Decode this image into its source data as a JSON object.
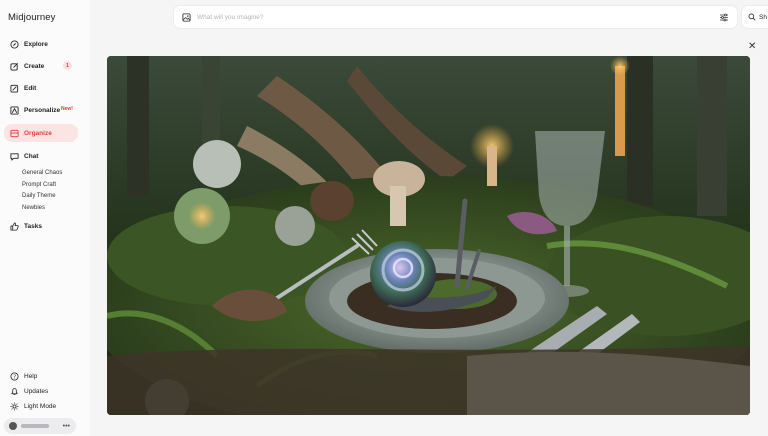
{
  "app": {
    "title": "Midjourney"
  },
  "sidebar": {
    "items": [
      {
        "key": "explore",
        "label": "Explore",
        "icon": "compass-icon"
      },
      {
        "key": "create",
        "label": "Create",
        "icon": "pencil-square-icon",
        "badge": "1"
      },
      {
        "key": "edit",
        "label": "Edit",
        "icon": "edit-icon"
      },
      {
        "key": "personalize",
        "label": "Personalize",
        "icon": "personalize-icon",
        "tag": "New!"
      },
      {
        "key": "organize",
        "label": "Organize",
        "icon": "folder-icon",
        "active": true
      },
      {
        "key": "chat",
        "label": "Chat",
        "icon": "chat-icon"
      },
      {
        "key": "tasks",
        "label": "Tasks",
        "icon": "thumbs-up-icon"
      }
    ],
    "chat_rooms": [
      "General Chaos",
      "Prompt Craft",
      "Daily Theme",
      "Newbies"
    ],
    "bottom": [
      {
        "key": "help",
        "label": "Help",
        "icon": "help-icon"
      },
      {
        "key": "updates",
        "label": "Updates",
        "icon": "bell-icon"
      },
      {
        "key": "light_mode",
        "label": "Light Mode",
        "icon": "sun-icon"
      }
    ]
  },
  "prompt": {
    "placeholder": "What will you imagine?"
  },
  "search": {
    "label": "Sh"
  },
  "colors": {
    "accent": "#e23c3c",
    "accent_bg": "#fde4e4"
  }
}
